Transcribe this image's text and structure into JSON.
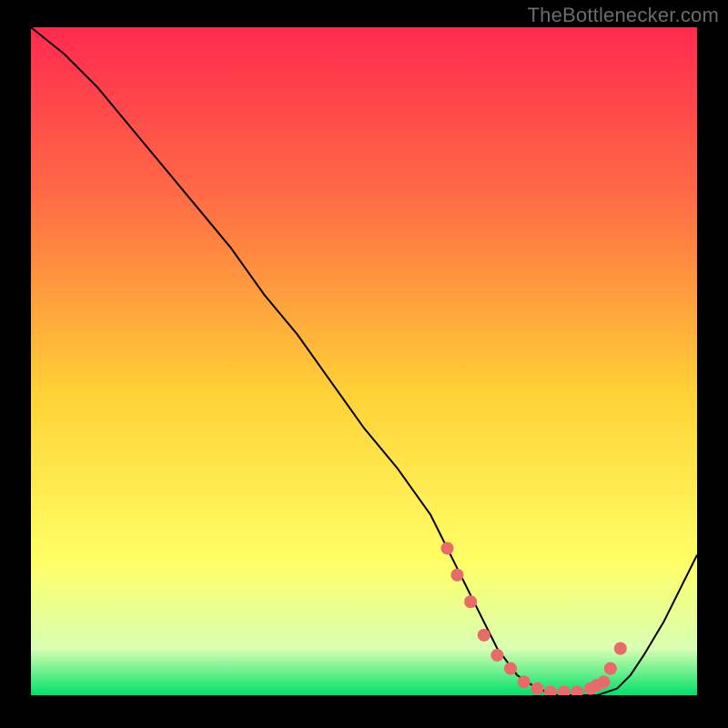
{
  "watermark": "TheBottlenecker.com",
  "chart_data": {
    "type": "line",
    "title": "",
    "xlabel": "",
    "ylabel": "",
    "xlim": [
      0,
      100
    ],
    "ylim": [
      0,
      100
    ],
    "grid": false,
    "legend": false,
    "background_gradient": {
      "top": "#ff2a4f",
      "mid1": "#ff6a45",
      "mid2": "#ffd236",
      "mid3": "#ffff66",
      "mid4": "#d9ffb3",
      "bottom": "#00e06a"
    },
    "curve": {
      "description": "V-shaped bottleneck curve",
      "x": [
        0,
        5,
        10,
        15,
        20,
        25,
        30,
        35,
        40,
        45,
        50,
        55,
        60,
        62,
        64,
        66,
        68,
        70,
        73,
        76,
        79,
        82,
        85,
        88,
        90,
        92,
        95,
        98,
        100
      ],
      "y": [
        100,
        96,
        91,
        85,
        79,
        73,
        67,
        60,
        54,
        47,
        40,
        34,
        27,
        23,
        19,
        15,
        11,
        7,
        3,
        1,
        0,
        0,
        0,
        1,
        3,
        6,
        11,
        17,
        21
      ]
    },
    "highlight_markers": {
      "color": "#e96a6a",
      "x": [
        62.5,
        64,
        66,
        68,
        70,
        72,
        74,
        76,
        78,
        80,
        82,
        84,
        85,
        86,
        87,
        88.5
      ],
      "y": [
        22,
        18,
        14,
        9,
        6,
        4,
        2,
        1,
        0.5,
        0.5,
        0.5,
        1,
        1.5,
        2,
        4,
        7
      ]
    }
  }
}
